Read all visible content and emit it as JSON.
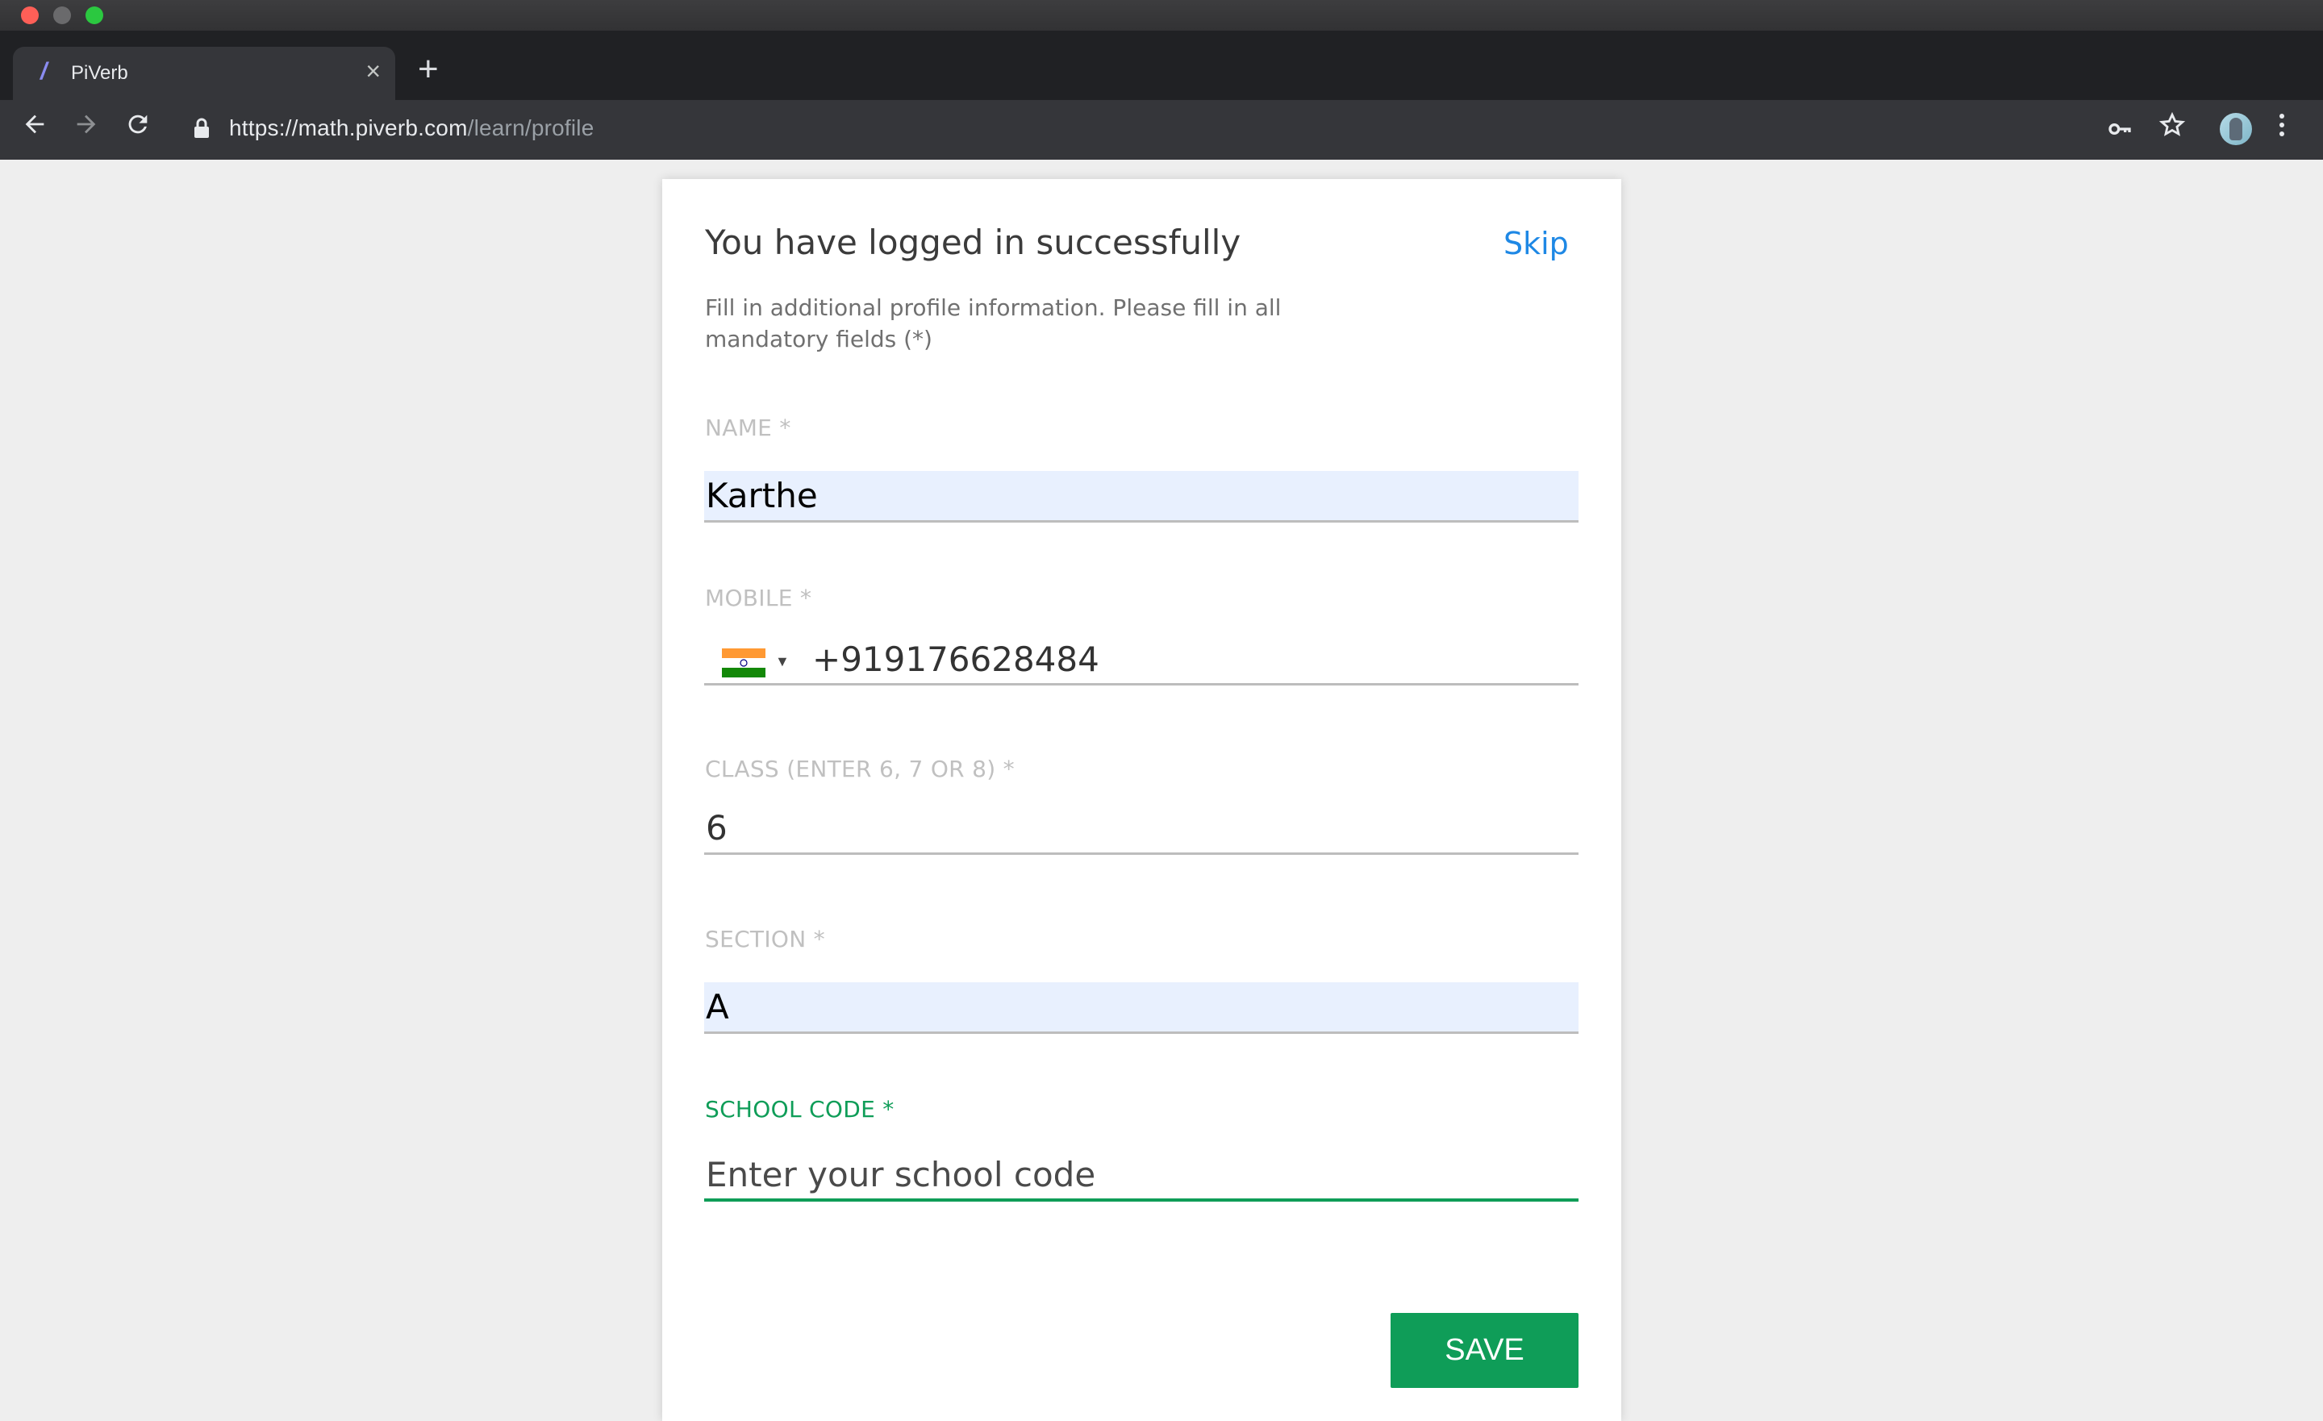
{
  "browser": {
    "tab_title": "PiVerb",
    "tab_favicon": "/",
    "tab_close": "×",
    "new_tab": "+",
    "url_base": "https://math.piverb.com",
    "url_path": "/learn/profile",
    "icons": [
      "back-arrow-icon",
      "forward-arrow-icon",
      "reload-icon",
      "lock-icon",
      "key-icon",
      "star-icon",
      "avatar",
      "more-vert-icon"
    ]
  },
  "card": {
    "title": "You have logged in successfully",
    "skip_label": "Skip",
    "subtitle": "Fill in additional profile information. Please fill in all mandatory fields (*)"
  },
  "form": {
    "name": {
      "label": "NAME *",
      "value": "Karthe"
    },
    "mobile": {
      "label": "MOBILE *",
      "value": "+919176628484",
      "country": "India"
    },
    "class": {
      "label": "CLASS (ENTER 6, 7 OR 8) *",
      "value": "6"
    },
    "section": {
      "label": "SECTION *",
      "value": "A"
    },
    "school_code": {
      "label": "SCHOOL CODE *",
      "value": "",
      "placeholder": "Enter your school code"
    },
    "save_label": "SAVE"
  },
  "colors": {
    "accent_green": "#0f9d58",
    "link_blue": "#1e88e5",
    "autofill_bg": "#e8f0fe"
  }
}
